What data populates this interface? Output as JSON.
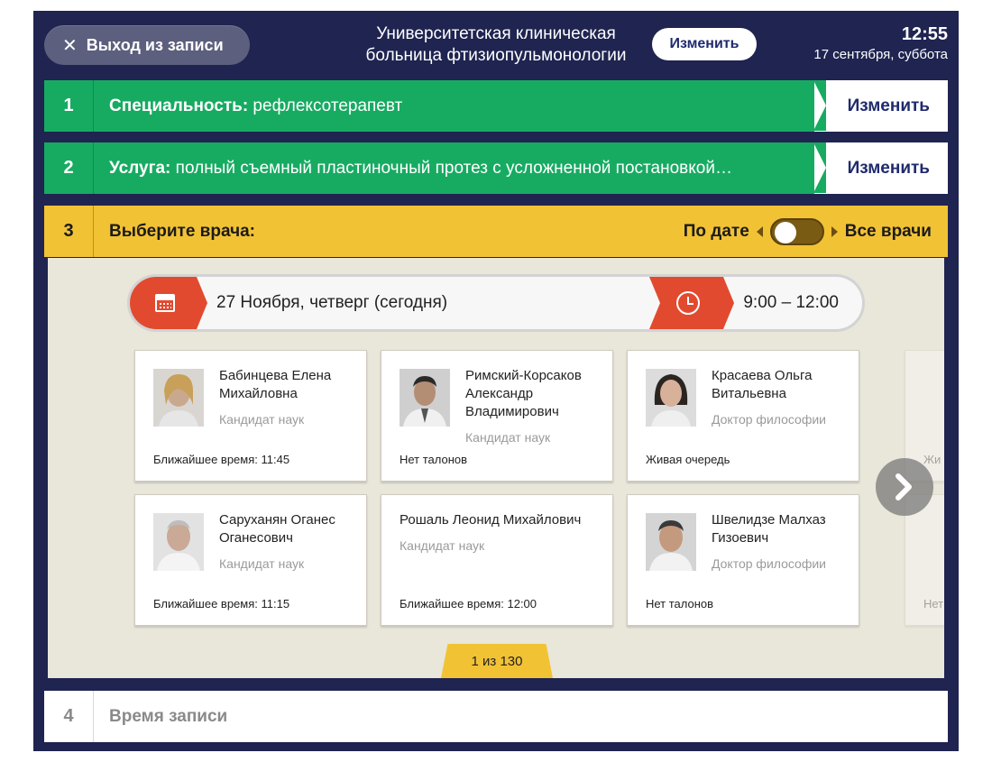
{
  "header": {
    "exit_label": "Выход из записи",
    "hospital_line1": "Университетская клиническая",
    "hospital_line2": "больница фтизиопульмонологии",
    "change_label": "Изменить",
    "time": "12:55",
    "date": "17 сентября, суббота"
  },
  "steps": [
    {
      "num": "1",
      "label": "Специальность:",
      "value": " рефлексотерапевт",
      "change": "Изменить"
    },
    {
      "num": "2",
      "label": "Услуга:",
      "value": " полный съемный пластиночный протез с усложненной постановкой…",
      "change": "Изменить"
    },
    {
      "num": "3",
      "label": "Выберите врача:",
      "toggle_left": "По дате",
      "toggle_right": "Все врачи"
    },
    {
      "num": "4",
      "label": "Время записи"
    }
  ],
  "schedule": {
    "date": "27 Ноября, четверг (сегодня)",
    "time_range": "9:00 – 12:00"
  },
  "doctors": [
    {
      "name": "Бабинцева Елена Михайловна",
      "degree": "Кандидат наук",
      "slot": "Ближайшее время: 11:45"
    },
    {
      "name": "Римский-Корсаков Александр Владимирович",
      "degree": "Кандидат наук",
      "slot": "Нет талонов"
    },
    {
      "name": "Красаева Ольга Витальевна",
      "degree": "Доктор философии",
      "slot": "Живая очередь"
    },
    {
      "name": "Саруханян Оганес Оганесович",
      "degree": "Кандидат наук",
      "slot": "Ближайшее время: 11:15"
    },
    {
      "name": "Рошаль Леонид Михайлович",
      "degree": "Кандидат наук",
      "slot": "Ближайшее время: 12:00"
    },
    {
      "name": "Швелидзе Малхаз Гизоевич",
      "degree": "Доктор философии",
      "slot": "Нет талонов"
    }
  ],
  "peek": [
    {
      "slot": "Жи"
    },
    {
      "slot": "Нет"
    }
  ],
  "pager": {
    "label": "1 из 130"
  },
  "colors": {
    "navy": "#1f2450",
    "green": "#17ab62",
    "yellow": "#f2c235",
    "red": "#e24a2f",
    "panel": "#e9e6da"
  }
}
